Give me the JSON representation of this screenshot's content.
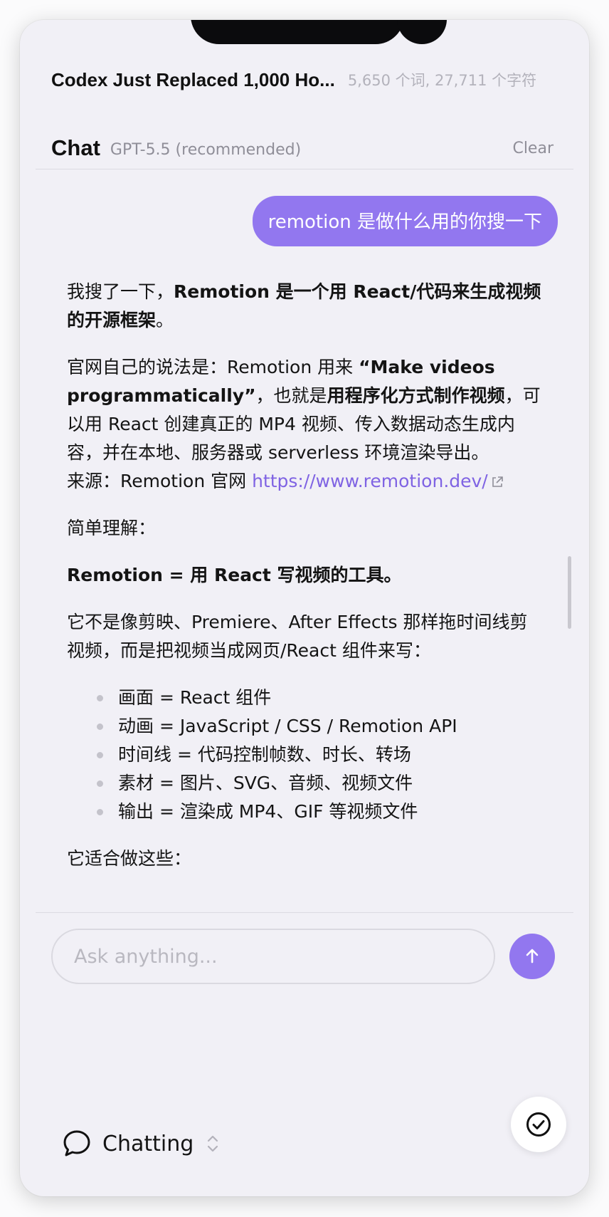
{
  "document": {
    "title": "Codex Just Replaced 1,000 Ho...",
    "stats": "5,650 个词, 27,711 个字符"
  },
  "chat": {
    "title": "Chat",
    "model": "GPT-5.5 (recommended)",
    "clear_label": "Clear"
  },
  "user_message": "remotion 是做什么用的你搜一下",
  "answer": {
    "p1_prefix": "我搜了一下，",
    "p1_bold": "Remotion 是一个用 React/代码来生成视频的开源框架",
    "p1_suffix": "。",
    "p2_a": "官网自己的说法是：Remotion 用来 ",
    "p2_bold1": "“Make videos programmatically”",
    "p2_b": "，也就是",
    "p2_bold2": "用程序化方式制作视频",
    "p2_c": "，可以用 React 创建真正的 MP4 视频、传入数据动态生成内容，并在本地、服务器或 serverless 环境渲染导出。",
    "source_prefix": "来源：Remotion 官网 ",
    "source_link": "https://www.remotion.dev/",
    "p3": "简单理解：",
    "p4_bold": "Remotion = 用 React 写视频的工具。",
    "p5": "它不是像剪映、Premiere、After Effects 那样拖时间线剪视频，而是把视频当成网页/React 组件来写：",
    "bullets": [
      "画面 = React 组件",
      "动画 = JavaScript / CSS / Remotion API",
      "时间线 = 代码控制帧数、时长、转场",
      "素材 = 图片、SVG、音频、视频文件",
      "输出 = 渲染成 MP4、GIF 等视频文件"
    ],
    "p6": "它适合做这些："
  },
  "input": {
    "placeholder": "Ask anything..."
  },
  "mode": {
    "label": "Chatting"
  },
  "colors": {
    "accent": "#9277ef",
    "link": "#7f63e3",
    "panel_bg": "#f1f0f6"
  },
  "icons": {
    "send": "arrow-up-icon",
    "external": "external-link-icon",
    "mode": "chat-bubble-icon",
    "chevrons": "chevron-up-down-icon",
    "done": "check-circle-icon"
  }
}
